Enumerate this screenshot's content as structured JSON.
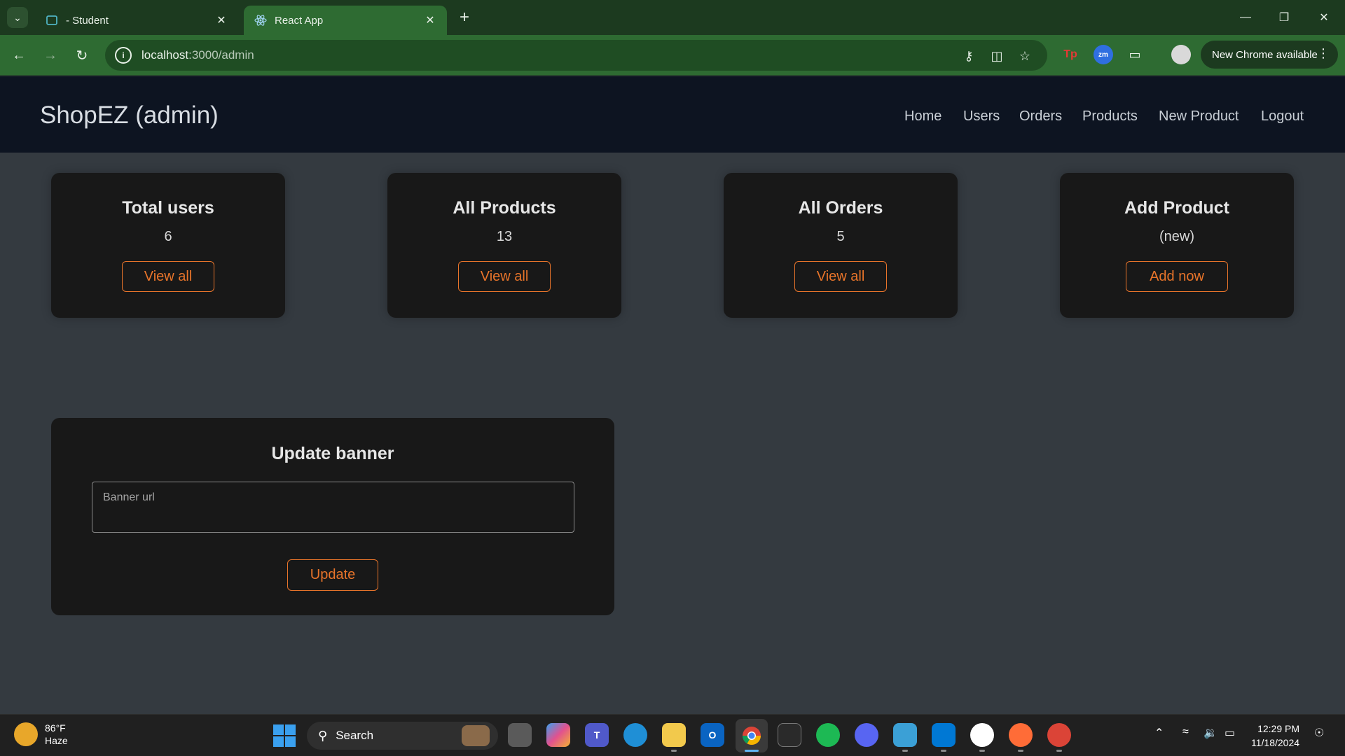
{
  "browser": {
    "tabs": [
      {
        "title": "- Student",
        "icon": "classroom-icon"
      },
      {
        "title": "React App",
        "icon": "react-icon",
        "active": true
      }
    ],
    "url_host": "localhost",
    "url_path": ":3000/admin",
    "new_chrome_label": "New Chrome available"
  },
  "navbar": {
    "brand": "ShopEZ (admin)",
    "links": [
      "Home",
      "Users",
      "Orders",
      "Products",
      "New Product",
      "Logout"
    ]
  },
  "cards": [
    {
      "title": "Total users",
      "value": "6",
      "button": "View all"
    },
    {
      "title": "All Products",
      "value": "13",
      "button": "View all"
    },
    {
      "title": "All Orders",
      "value": "5",
      "button": "View all"
    },
    {
      "title": "Add Product",
      "value": "(new)",
      "button": "Add now"
    }
  ],
  "banner": {
    "title": "Update banner",
    "placeholder": "Banner url",
    "value": "",
    "button": "Update"
  },
  "taskbar": {
    "weather_temp": "86°F",
    "weather_desc": "Haze",
    "search_label": "Search",
    "time": "12:29 PM",
    "date": "11/18/2024"
  },
  "colors": {
    "accent": "#e8742a",
    "navbar_bg": "#0d1421",
    "page_bg": "#343a40",
    "card_bg": "#181818",
    "chrome_toolbar": "#2e6b32"
  }
}
